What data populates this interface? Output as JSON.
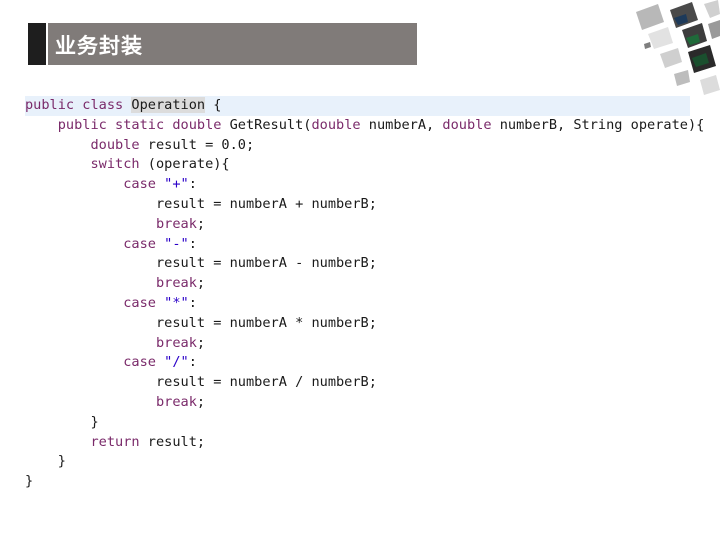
{
  "title": "业务封装",
  "code": [
    [
      {
        "t": "public class ",
        "k": "kw"
      },
      {
        "t": "Operation",
        "k": "hl"
      },
      {
        "t": " {"
      }
    ],
    [
      {
        "t": "    "
      },
      {
        "t": "public static double",
        "k": "kw"
      },
      {
        "t": " GetResult("
      },
      {
        "t": "double",
        "k": "kw"
      },
      {
        "t": " numberA, "
      },
      {
        "t": "double",
        "k": "kw"
      },
      {
        "t": " numberB, String operate){"
      }
    ],
    [
      {
        "t": "        "
      },
      {
        "t": "double",
        "k": "kw"
      },
      {
        "t": " result = 0.0;"
      }
    ],
    [
      {
        "t": "        "
      },
      {
        "t": "switch",
        "k": "kw"
      },
      {
        "t": " (operate){"
      }
    ],
    [
      {
        "t": "            "
      },
      {
        "t": "case",
        "k": "kw"
      },
      {
        "t": " "
      },
      {
        "t": "\"+\"",
        "k": "str"
      },
      {
        "t": ":"
      }
    ],
    [
      {
        "t": "                result = numberA + numberB;"
      }
    ],
    [
      {
        "t": "                "
      },
      {
        "t": "break",
        "k": "kw"
      },
      {
        "t": ";"
      }
    ],
    [
      {
        "t": "            "
      },
      {
        "t": "case",
        "k": "kw"
      },
      {
        "t": " "
      },
      {
        "t": "\"-\"",
        "k": "str"
      },
      {
        "t": ":"
      }
    ],
    [
      {
        "t": "                result = numberA - numberB;"
      }
    ],
    [
      {
        "t": "                "
      },
      {
        "t": "break",
        "k": "kw"
      },
      {
        "t": ";"
      }
    ],
    [
      {
        "t": "            "
      },
      {
        "t": "case",
        "k": "kw"
      },
      {
        "t": " "
      },
      {
        "t": "\"*\"",
        "k": "str"
      },
      {
        "t": ":"
      }
    ],
    [
      {
        "t": "                result = numberA * numberB;"
      }
    ],
    [
      {
        "t": "                "
      },
      {
        "t": "break",
        "k": "kw"
      },
      {
        "t": ";"
      }
    ],
    [
      {
        "t": "            "
      },
      {
        "t": "case",
        "k": "kw"
      },
      {
        "t": " "
      },
      {
        "t": "\"/\"",
        "k": "str"
      },
      {
        "t": ":"
      }
    ],
    [
      {
        "t": "                result = numberA / numberB;"
      }
    ],
    [
      {
        "t": "                "
      },
      {
        "t": "break",
        "k": "kw"
      },
      {
        "t": ";"
      }
    ],
    [
      {
        "t": "        }"
      }
    ],
    [
      {
        "t": "        "
      },
      {
        "t": "return",
        "k": "kw"
      },
      {
        "t": " result;"
      }
    ],
    [
      {
        "t": "    }"
      }
    ],
    [
      {
        "t": "}"
      }
    ]
  ]
}
